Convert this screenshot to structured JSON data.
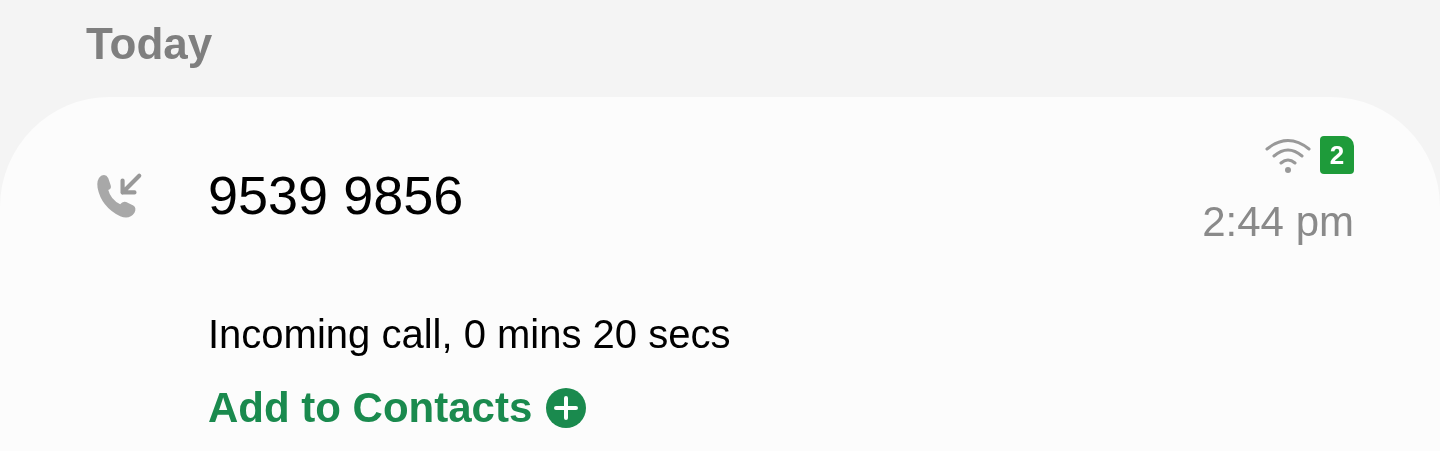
{
  "section_header": "Today",
  "call": {
    "kind": "incoming",
    "number": "9539 9856",
    "sim": "2",
    "time": "2:44 pm",
    "wifi_calling": true,
    "detail": "Incoming call, 0 mins 20 secs",
    "action": "Add to Contacts"
  }
}
